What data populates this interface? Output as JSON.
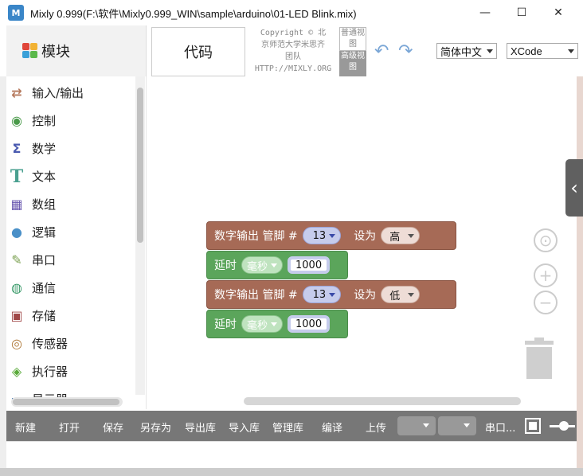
{
  "window": {
    "icon_text": "M",
    "title": "Mixly 0.999(F:\\软件\\Mixly0.999_WIN\\sample\\arduino\\01-LED Blink.mix)",
    "minimize": "—",
    "maximize": "☐",
    "close": "✕"
  },
  "header": {
    "modules_label": "模块",
    "code_tab": "代码",
    "copyright_lines": [
      "Copyright © 北",
      "京师范大学米思齐",
      "团队",
      "HTTP://MIXLY.ORG"
    ],
    "normal_view": "普通视图",
    "advanced_view": "高级视图",
    "undo_icon": "↶",
    "redo_icon": "↷",
    "language_select": "简体中文",
    "theme_select": "XCode"
  },
  "sidebar": {
    "items": [
      {
        "label": "输入/输出",
        "icon": "⇄",
        "color": "#b67a5e"
      },
      {
        "label": "控制",
        "icon": "◉",
        "color": "#4a9a4a"
      },
      {
        "label": "数学",
        "icon": "Σ",
        "color": "#4a5ab0"
      },
      {
        "label": "文本",
        "icon": "T",
        "color": "#4aa090"
      },
      {
        "label": "数组",
        "icon": "▦",
        "color": "#6a58b0"
      },
      {
        "label": "逻辑",
        "icon": "●",
        "color": "#4a90c8"
      },
      {
        "label": "串口",
        "icon": "✎",
        "color": "#7aa050"
      },
      {
        "label": "通信",
        "icon": "◍",
        "color": "#3a9a6a"
      },
      {
        "label": "存储",
        "icon": "▣",
        "color": "#a04848"
      },
      {
        "label": "传感器",
        "icon": "◎",
        "color": "#b07a3a"
      },
      {
        "label": "执行器",
        "icon": "◈",
        "color": "#5aaa3a"
      },
      {
        "label": "显示器",
        "icon": "▭",
        "color": "#4a7ab0"
      }
    ]
  },
  "blocks": [
    {
      "type": "digital-write",
      "label": "数字输出 管脚 #",
      "pin": "13",
      "set_label": "设为",
      "level": "高"
    },
    {
      "type": "delay",
      "label": "延时",
      "unit": "毫秒",
      "value": "1000"
    },
    {
      "type": "digital-write",
      "label": "数字输出 管脚 #",
      "pin": "13",
      "set_label": "设为",
      "level": "低"
    },
    {
      "type": "delay",
      "label": "延时",
      "unit": "毫秒",
      "value": "1000"
    }
  ],
  "workspace": {
    "center_icon": "⊙",
    "zoom_in": "+",
    "zoom_out": "−",
    "flyout_toggle": "‹"
  },
  "toolbar": {
    "new": "新建",
    "open": "打开",
    "save": "保存",
    "save_as": "另存为",
    "export_lib": "导出库",
    "import_lib": "导入库",
    "manage_lib": "管理库",
    "compile": "编译",
    "upload": "上传",
    "serial": "串口..."
  }
}
